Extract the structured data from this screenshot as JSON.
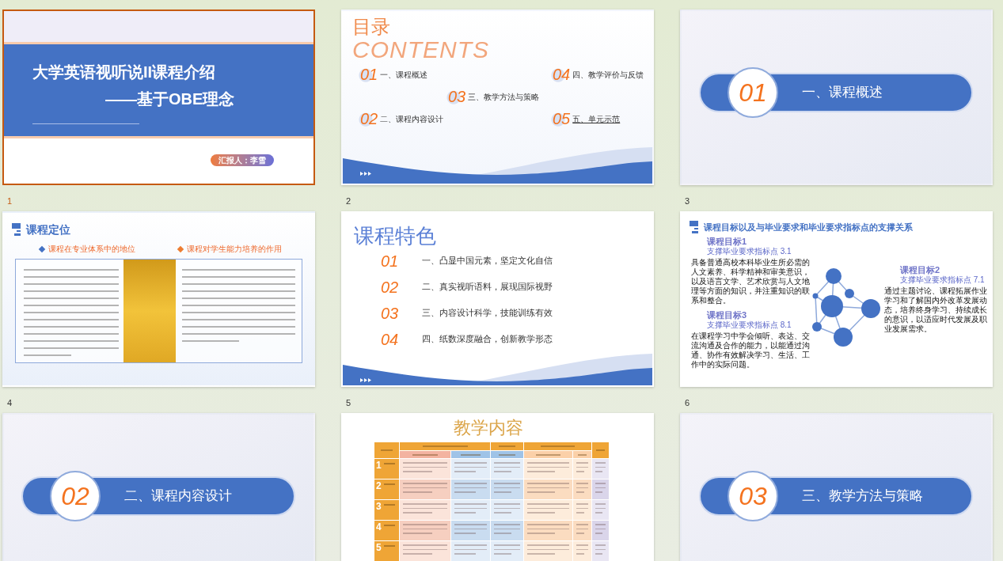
{
  "slides": [
    {
      "slide_number": "1",
      "selected": true,
      "kind": "title",
      "title": "大学英语视听说II课程介绍",
      "subtitle": "——基于OBE理念",
      "presenter": "汇报人：李雪"
    },
    {
      "slide_number": "2",
      "selected": false,
      "kind": "contents",
      "heading": "目录",
      "heading_en": "CONTENTS",
      "items": [
        {
          "numeral": "01",
          "label": "一、课程概述",
          "linked": false
        },
        {
          "numeral": "02",
          "label": "二、课程内容设计",
          "linked": false
        },
        {
          "numeral": "03",
          "label": "三、教学方法与策略",
          "linked": false
        },
        {
          "numeral": "04",
          "label": "四、教学评价与反馈",
          "linked": false
        },
        {
          "numeral": "05",
          "label": "五、单元示范",
          "linked": true
        }
      ]
    },
    {
      "slide_number": "3",
      "selected": false,
      "kind": "section",
      "numeral": "01",
      "heading": "一、课程概述"
    },
    {
      "slide_number": "4",
      "selected": false,
      "kind": "positioning",
      "title": "课程定位",
      "columns": [
        {
          "heading": "课程在专业体系中的地位",
          "color": "#4472c4"
        },
        {
          "heading": "课程对学生能力培养的作用",
          "color": "#ed7d31"
        }
      ]
    },
    {
      "slide_number": "5",
      "selected": false,
      "kind": "features",
      "title": "课程特色",
      "items": [
        {
          "numeral": "01",
          "label": "一、凸显中国元素，坚定文化自信"
        },
        {
          "numeral": "02",
          "label": "二、真实视听语料，展现国际视野"
        },
        {
          "numeral": "03",
          "label": "三、内容设计科学，技能训练有效"
        },
        {
          "numeral": "04",
          "label": "四、纸数深度融合，创新教学形态"
        }
      ]
    },
    {
      "slide_number": "6",
      "selected": false,
      "kind": "goals",
      "title": "课程目标以及与毕业要求和毕业要求指标点的支撑关系",
      "goals": [
        {
          "title": "课程目标1",
          "support": "支撑毕业要求指标点 3.1",
          "text": "具备普通高校本科毕业生所必需的人文素养、科学精神和审美意识，以及语言文学、艺术欣赏与人文地理等方面的知识，并注重知识的联系和整合。"
        },
        {
          "title": "课程目标2",
          "support": "支撑毕业要求指标点 7.1",
          "text": "通过主题讨论、课程拓展作业学习和了解国内外改革发展动态，培养终身学习、持续成长的意识，以适应时代发展及职业发展需求。"
        },
        {
          "title": "课程目标3",
          "support": "支撑毕业要求指标点 8.1",
          "text": "在课程学习中学会倾听、表达、交流沟通及合作的能力，以能通过沟通、协作有效解决学习、生活、工作中的实际问题。"
        }
      ]
    },
    {
      "selected": false,
      "kind": "section",
      "numeral": "02",
      "heading": "二、课程内容设计"
    },
    {
      "selected": false,
      "kind": "table",
      "title": "教学内容",
      "units": [
        "1",
        "2",
        "3",
        "4",
        "5"
      ]
    },
    {
      "selected": false,
      "kind": "section",
      "numeral": "03",
      "heading": "三、教学方法与策略"
    }
  ]
}
